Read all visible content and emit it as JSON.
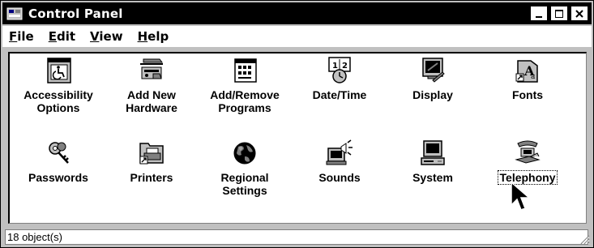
{
  "window": {
    "title": "Control Panel",
    "icon": "control-panel-icon",
    "controls": {
      "minimize": "minimize-icon",
      "maximize": "maximize-icon",
      "close": "close-icon"
    }
  },
  "menu": [
    {
      "label": "File",
      "accel": "F"
    },
    {
      "label": "Edit",
      "accel": "E"
    },
    {
      "label": "View",
      "accel": "V"
    },
    {
      "label": "Help",
      "accel": "H"
    }
  ],
  "icons": [
    {
      "label1": "Accessibility",
      "label2": "Options",
      "icon": "accessibility-icon"
    },
    {
      "label1": "Add New",
      "label2": "Hardware",
      "icon": "add-hardware-icon"
    },
    {
      "label1": "Add/Remove",
      "label2": "Programs",
      "icon": "add-remove-programs-icon"
    },
    {
      "label1": "Date/Time",
      "label2": "",
      "icon": "date-time-icon"
    },
    {
      "label1": "Display",
      "label2": "",
      "icon": "display-icon"
    },
    {
      "label1": "Fonts",
      "label2": "",
      "icon": "fonts-icon"
    },
    {
      "label1": "Passwords",
      "label2": "",
      "icon": "passwords-icon"
    },
    {
      "label1": "Printers",
      "label2": "",
      "icon": "printers-icon"
    },
    {
      "label1": "Regional",
      "label2": "Settings",
      "icon": "regional-settings-icon"
    },
    {
      "label1": "Sounds",
      "label2": "",
      "icon": "sounds-icon"
    },
    {
      "label1": "System",
      "label2": "",
      "icon": "system-icon"
    },
    {
      "label1": "Telephony",
      "label2": "",
      "icon": "telephony-icon",
      "selected": true
    }
  ],
  "status": {
    "text": "18 object(s)"
  },
  "colors": {
    "face": "#c0c0c0",
    "title_bg": "#000000",
    "window_bg": "#ffffff"
  }
}
